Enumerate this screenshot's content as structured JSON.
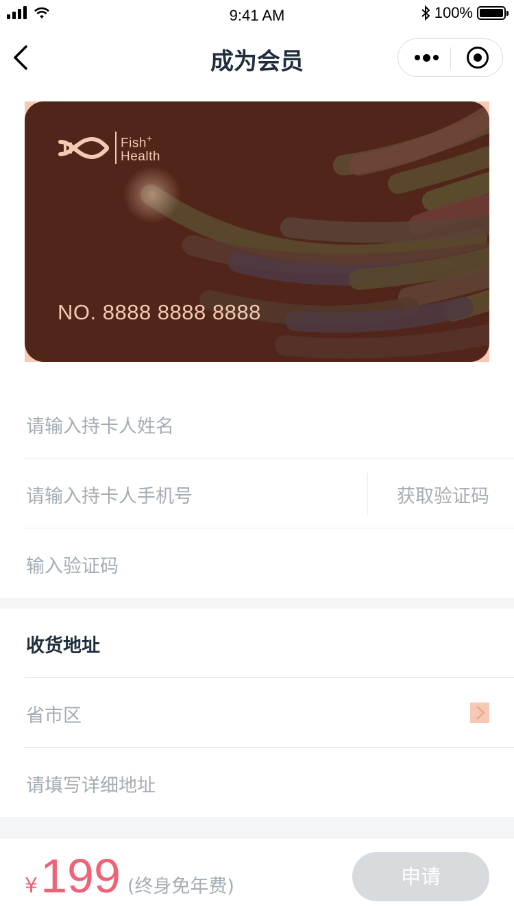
{
  "status_bar": {
    "time": "9:41 AM",
    "battery": "100%"
  },
  "nav": {
    "title": "成为会员"
  },
  "card": {
    "brand_line1": "Fish",
    "brand_plus": "+",
    "brand_line2": "Health",
    "number": "NO. 8888 8888 8888"
  },
  "form": {
    "name_placeholder": "请输入持卡人姓名",
    "phone_placeholder": "请输入持卡人手机号",
    "get_code_label": "获取验证码",
    "code_placeholder": "输入验证码"
  },
  "address": {
    "title": "收货地址",
    "region_placeholder": "省市区",
    "detail_placeholder": "请填写详细地址"
  },
  "footer": {
    "currency": "¥",
    "price": "199",
    "note": "(终身免年费)",
    "apply_label": "申请"
  },
  "colors": {
    "card_bg": "#512519",
    "accent_peach": "#f6c9b4",
    "price_pink": "#f06277",
    "placeholder_gray": "#a4adb6",
    "button_disabled": "#d7dbde"
  }
}
